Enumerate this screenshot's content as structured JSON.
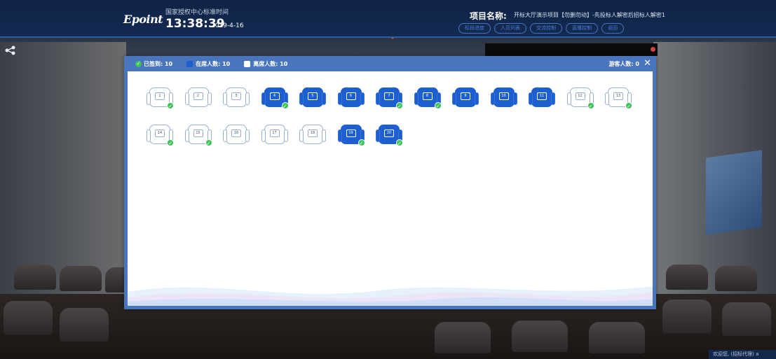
{
  "header": {
    "logo": "Epoint",
    "time_label": "国家授权中心标准时间",
    "time": "13:38:39",
    "date": "2019-4-16",
    "project_label": "项目名称:",
    "project_value": "开标大厅演示项目【勿删勿动】-先投标人解密后招标人解密1",
    "nav": [
      "标段进度",
      "人员列表",
      "交流控制",
      "直播控制",
      "返回"
    ]
  },
  "modal": {
    "signed_label": "已签到: 10",
    "online_label": "在席人数: 10",
    "offline_label": "离席人数: 10",
    "visitor_label": "游客人数: 0",
    "close": "✕"
  },
  "seats": [
    {
      "num": "1",
      "online": false,
      "checked": true
    },
    {
      "num": "2",
      "online": false,
      "checked": false
    },
    {
      "num": "3",
      "online": false,
      "checked": false
    },
    {
      "num": "4",
      "online": true,
      "checked": true
    },
    {
      "num": "5",
      "online": true,
      "checked": false
    },
    {
      "num": "6",
      "online": true,
      "checked": false
    },
    {
      "num": "7",
      "online": true,
      "checked": true
    },
    {
      "num": "8",
      "online": true,
      "checked": true
    },
    {
      "num": "9",
      "online": true,
      "checked": false
    },
    {
      "num": "10",
      "online": true,
      "checked": false
    },
    {
      "num": "11",
      "online": true,
      "checked": false
    },
    {
      "num": "12",
      "online": false,
      "checked": true
    },
    {
      "num": "13",
      "online": false,
      "checked": true
    },
    {
      "num": "14",
      "online": false,
      "checked": true
    },
    {
      "num": "15",
      "online": false,
      "checked": true
    },
    {
      "num": "16",
      "online": false,
      "checked": false
    },
    {
      "num": "17",
      "online": false,
      "checked": false
    },
    {
      "num": "18",
      "online": false,
      "checked": false
    },
    {
      "num": "19",
      "online": true,
      "checked": true
    },
    {
      "num": "20",
      "online": true,
      "checked": true
    }
  ],
  "footer": {
    "welcome": "欢迎您, (招标代理) a"
  },
  "colors": {
    "primary": "#4975bd",
    "online_seat": "#1e5fcf",
    "check": "#3fc25b",
    "header_bg": "#0f2345"
  },
  "icons": {
    "check": "check-circle-icon",
    "close": "close-icon",
    "side": "share-icon"
  }
}
